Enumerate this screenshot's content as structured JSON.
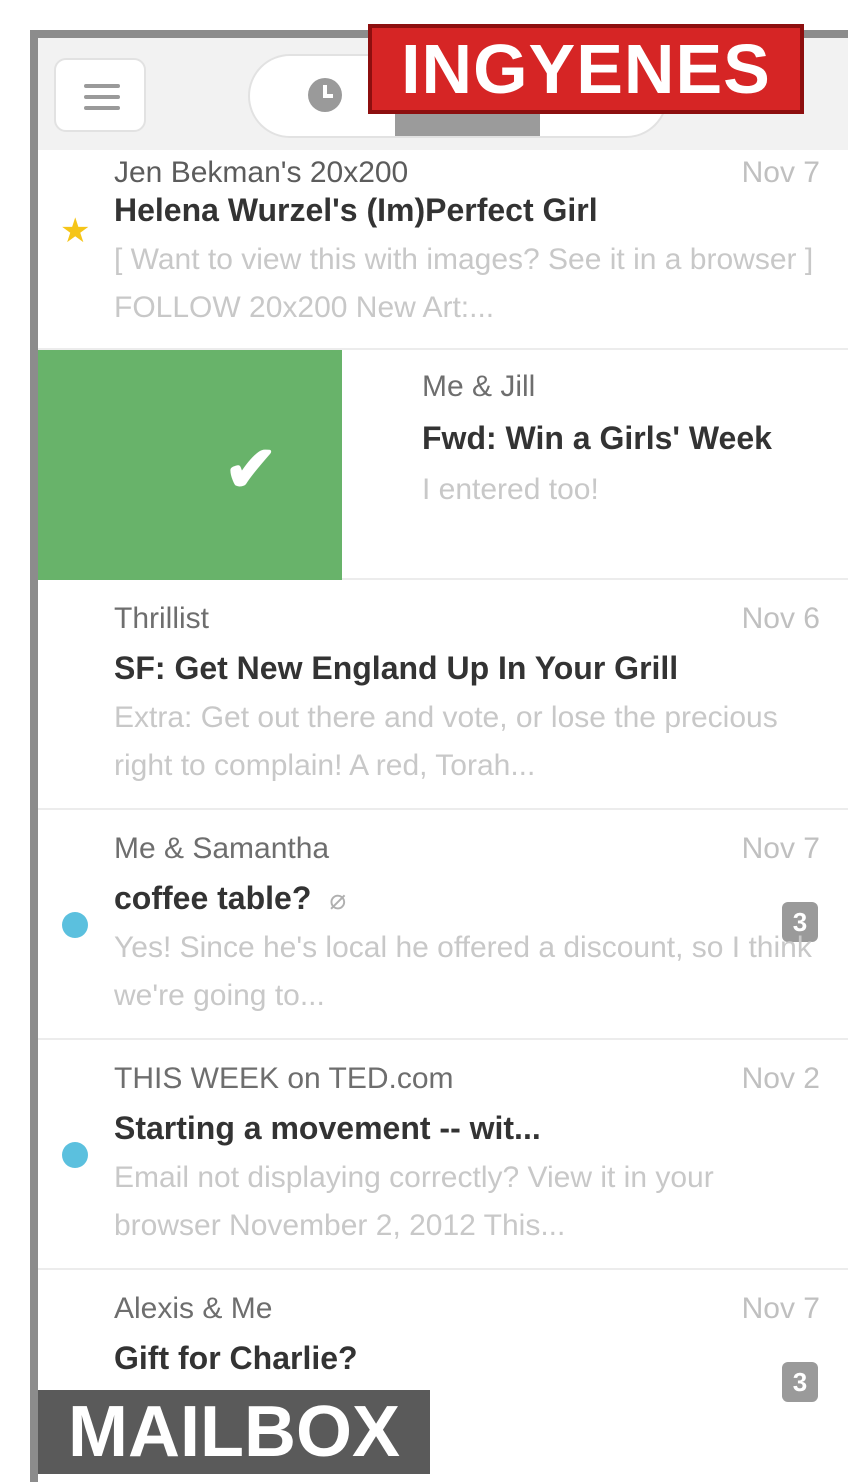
{
  "badges": {
    "top_right": "INGYENES",
    "bottom_left": "MAILBOX"
  },
  "toolbar": {
    "menu_icon": "hamburger-icon",
    "later_icon": "clock-icon"
  },
  "messages": [
    {
      "sender": "Jen Bekman's 20x200",
      "date": "Nov 7",
      "subject": "Helena Wurzel's (Im)Perfect Girl",
      "preview": "[ Want to view this with images? See it in a browser ] FOLLOW 20x200 New Art:...",
      "starred": true
    },
    {
      "sender": "Me & Jill",
      "date": "",
      "subject": "Fwd: Win a Girls' Week",
      "preview": "I entered too!",
      "swiped": true
    },
    {
      "sender": "Thrillist",
      "date": "Nov 6",
      "subject": "SF: Get New England Up In Your Grill",
      "preview": "Extra: Get out there and vote, or lose the precious right to complain! A red, Torah..."
    },
    {
      "sender": "Me & Samantha",
      "date": "Nov 7",
      "subject": "coffee table?",
      "preview": "Yes! Since he's local he offered a discount, so I think we're going to...",
      "unread": true,
      "attachment": true,
      "count": "3"
    },
    {
      "sender": "THIS WEEK on TED.com",
      "date": "Nov 2",
      "subject": "Starting a movement -- wit...",
      "preview": "Email not displaying correctly? View it in your browser November 2, 2012 This...",
      "unread": true
    },
    {
      "sender": "Alexis & Me",
      "date": "Nov 7",
      "subject": "Gift for Charlie?",
      "preview": "",
      "starred": true,
      "count": "3"
    }
  ],
  "colors": {
    "swipe_archive": "#68b36a",
    "unread_dot": "#5bc0de",
    "star": "#f5c518",
    "ingyenes_badge": "#d62525"
  }
}
